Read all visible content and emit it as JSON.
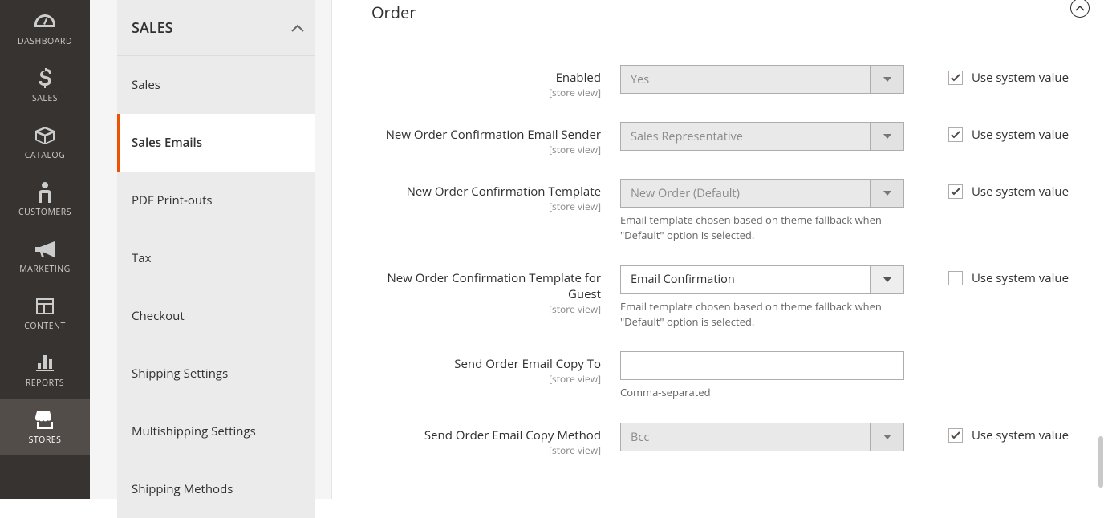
{
  "left_nav": [
    {
      "id": "dashboard",
      "label": "DASHBOARD"
    },
    {
      "id": "sales",
      "label": "SALES"
    },
    {
      "id": "catalog",
      "label": "CATALOG"
    },
    {
      "id": "customers",
      "label": "CUSTOMERS"
    },
    {
      "id": "marketing",
      "label": "MARKETING"
    },
    {
      "id": "content",
      "label": "CONTENT"
    },
    {
      "id": "reports",
      "label": "REPORTS"
    },
    {
      "id": "stores",
      "label": "STORES",
      "active": true
    }
  ],
  "sub_nav": {
    "header": "SALES",
    "items": [
      {
        "label": "Sales"
      },
      {
        "label": "Sales Emails",
        "active": true
      },
      {
        "label": "PDF Print-outs"
      },
      {
        "label": "Tax"
      },
      {
        "label": "Checkout"
      },
      {
        "label": "Shipping Settings"
      },
      {
        "label": "Multishipping Settings"
      },
      {
        "label": "Shipping Methods"
      }
    ]
  },
  "section_title": "Order",
  "scope_label": "[store view]",
  "use_system_label": "Use system value",
  "helpers": {
    "template": "Email template chosen based on theme fallback when \"Default\" option is selected.",
    "copy_to": "Comma-separated"
  },
  "fields": {
    "enabled": {
      "label": "Enabled",
      "value": "Yes",
      "use_system": true,
      "disabled": true
    },
    "sender": {
      "label": "New Order Confirmation Email Sender",
      "value": "Sales Representative",
      "use_system": true,
      "disabled": true
    },
    "template": {
      "label": "New Order Confirmation Template",
      "value": "New Order (Default)",
      "use_system": true,
      "disabled": true
    },
    "guest_template": {
      "label": "New Order Confirmation Template for Guest",
      "value": "Email Confirmation",
      "use_system": false,
      "disabled": false
    },
    "copy_to": {
      "label": "Send Order Email Copy To",
      "value": ""
    },
    "copy_method": {
      "label": "Send Order Email Copy Method",
      "value": "Bcc",
      "use_system": true,
      "disabled": true
    }
  }
}
